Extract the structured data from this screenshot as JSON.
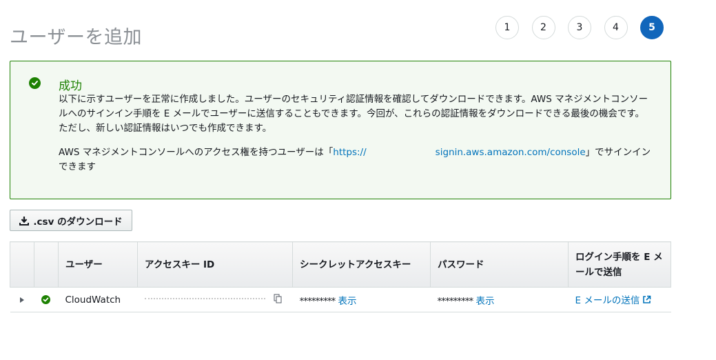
{
  "header": {
    "title": "ユーザーを追加",
    "steps": [
      "1",
      "2",
      "3",
      "4",
      "5"
    ],
    "active_step": "5"
  },
  "alert": {
    "title": "成功",
    "paragraph1": "以下に示すユーザーを正常に作成しました。ユーザーのセキュリティ認証情報を確認してダウンロードできます。AWS マネジメントコンソールへのサインイン手順を E メールでユーザーに送信することもできます。今回が、これらの認証情報をダウンロードできる最後の機会です。ただし、新しい認証情報はいつでも作成できます。",
    "paragraph2_prefix": "AWS マネジメントコンソールへのアクセス権を持つユーザーは「",
    "console_url_start": "https://",
    "console_url_end": "signin.aws.amazon.com/console",
    "paragraph2_suffix": "」でサインインできます",
    "icon": "check-circle-icon",
    "color": "#1d8102"
  },
  "download": {
    "label": ".csv のダウンロード",
    "icon": "download-icon"
  },
  "table": {
    "headers": {
      "user": "ユーザー",
      "access_key_id": "アクセスキー ID",
      "secret_key": "シークレットアクセスキー",
      "password": "パスワード",
      "email_instructions": "ログイン手順を E メールで送信"
    },
    "rows": [
      {
        "user": "CloudWatch",
        "secret_masked": "*********",
        "secret_show": "表示",
        "password_masked": "*********",
        "password_show": "表示",
        "email_link": "E メールの送信"
      }
    ]
  },
  "colors": {
    "accent": "#1166bb",
    "link": "#0073bb",
    "success": "#1d8102"
  }
}
